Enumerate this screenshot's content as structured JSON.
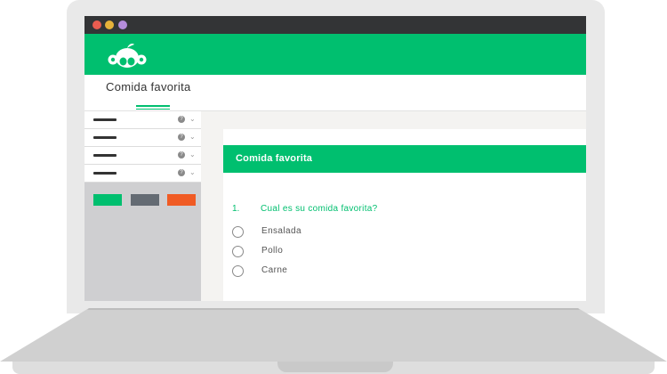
{
  "window": {
    "controls": [
      "close",
      "minimize",
      "zoom"
    ]
  },
  "brand": {
    "logo_icon": "surveymonkey-logo-icon",
    "accent_color": "#00bf6f"
  },
  "survey": {
    "title": "Comida favorita"
  },
  "sidebar": {
    "rows": 4,
    "buttons": [
      {
        "color": "#00bf6f"
      },
      {
        "color": "#646b73"
      },
      {
        "color": "#f05b24"
      }
    ]
  },
  "card": {
    "header_title": "Comida favorita",
    "question": {
      "number": "1.",
      "text": "Cual es su comida favorita?",
      "options": [
        "Ensalada",
        "Pollo",
        "Carne"
      ]
    }
  }
}
